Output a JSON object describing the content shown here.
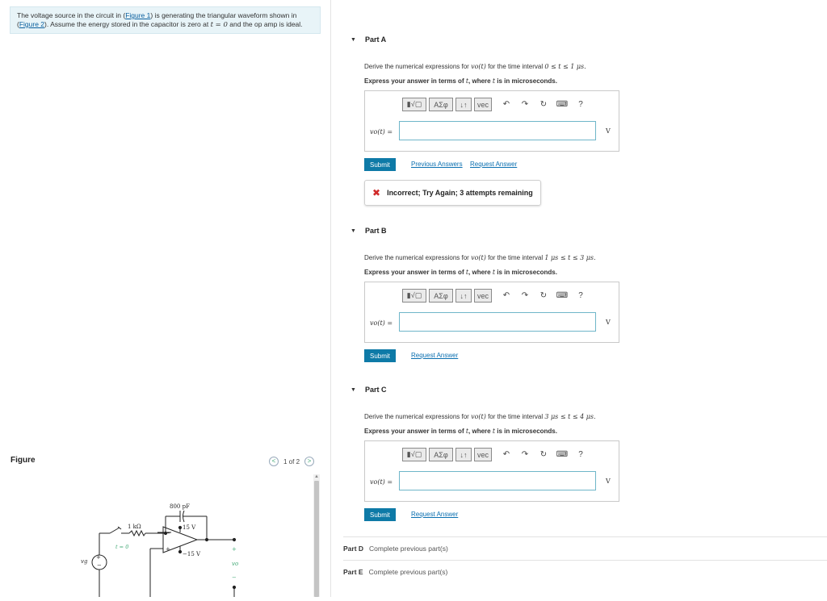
{
  "intro": {
    "t1": "The voltage source in the circuit in (",
    "fig1": "Figure 1",
    "t2": ") is generating the triangular waveform shown in",
    "t3": "(",
    "fig2": "Figure 2",
    "t4": "). Assume the energy stored in the capacitor is zero at ",
    "math": "t = 0",
    "t5": " and the op amp is ideal."
  },
  "figure": {
    "label": "Figure",
    "page": "1 of 2",
    "prev": "<",
    "next": ">",
    "capacitor": "800 pF",
    "resistor": "1 kΩ",
    "switch_time": "t = 0",
    "vplus": "15 V",
    "vminus": "−15 V",
    "source": "vg",
    "output": "vo",
    "plus": "+",
    "minus": "−"
  },
  "toolbar": {
    "templates": "▮√▢",
    "greek": "ΑΣφ",
    "arrows": "↓↑",
    "vec": "vec",
    "undo": "↶",
    "redo": "↷",
    "reset": "↻",
    "keyboard": "⌨",
    "help": "?"
  },
  "common": {
    "lhs": "vo(t) =",
    "unit": "V",
    "submit": "Submit",
    "express_a": "Express your answer in terms of ",
    "express_t": "t",
    "express_b": ", where ",
    "express_c": " is in microseconds.",
    "derive_a": "Derive the numerical expressions for ",
    "derive_v": "vo(t)",
    "derive_b": " for the time interval "
  },
  "partA": {
    "title": "Part A",
    "interval": "0 ≤ t ≤ 1 μs.",
    "previous_answers": "Previous Answers",
    "request_answer": "Request Answer",
    "feedback": "Incorrect; Try Again; 3 attempts remaining",
    "feedback_icon": "✖"
  },
  "partB": {
    "title": "Part B",
    "interval": "1 μs ≤ t ≤ 3 μs.",
    "request_answer": "Request Answer"
  },
  "partC": {
    "title": "Part C",
    "interval": "3 μs ≤ t ≤ 4 μs.",
    "request_answer": "Request Answer"
  },
  "partD": {
    "label": "Part D",
    "text": "Complete previous part(s)"
  },
  "partE": {
    "label": "Part E",
    "text": "Complete previous part(s)"
  }
}
